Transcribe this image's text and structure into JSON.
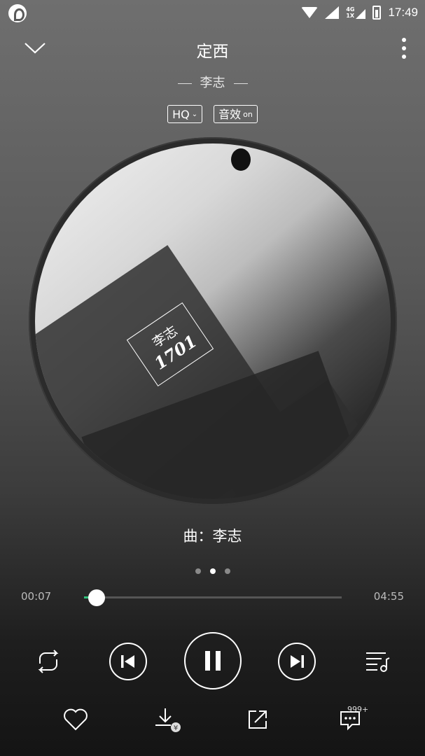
{
  "status_bar": {
    "network": "4G",
    "network_sub": "1X",
    "time": "17:49"
  },
  "header": {
    "title": "定西",
    "artist": "李志",
    "quality_badge": "HQ",
    "effect_badge": "音效",
    "effect_state": "on"
  },
  "album": {
    "stamp_line1": "李志",
    "stamp_line2": "1701"
  },
  "composer": "曲：李志",
  "pager": {
    "pages": 3,
    "active_index": 1
  },
  "progress": {
    "current": "00:07",
    "total": "04:55",
    "fraction": 0.024,
    "accent_color": "#31c27c"
  },
  "controls": {
    "repeat_icon": "repeat-icon",
    "prev_icon": "skip-previous-icon",
    "play_state_icon": "pause-icon",
    "next_icon": "skip-next-icon",
    "playlist_icon": "playlist-icon"
  },
  "actions": {
    "like_icon": "heart-icon",
    "download_icon": "download-paid-icon",
    "share_icon": "share-icon",
    "comment_icon": "comment-icon",
    "comment_count": "999+"
  }
}
